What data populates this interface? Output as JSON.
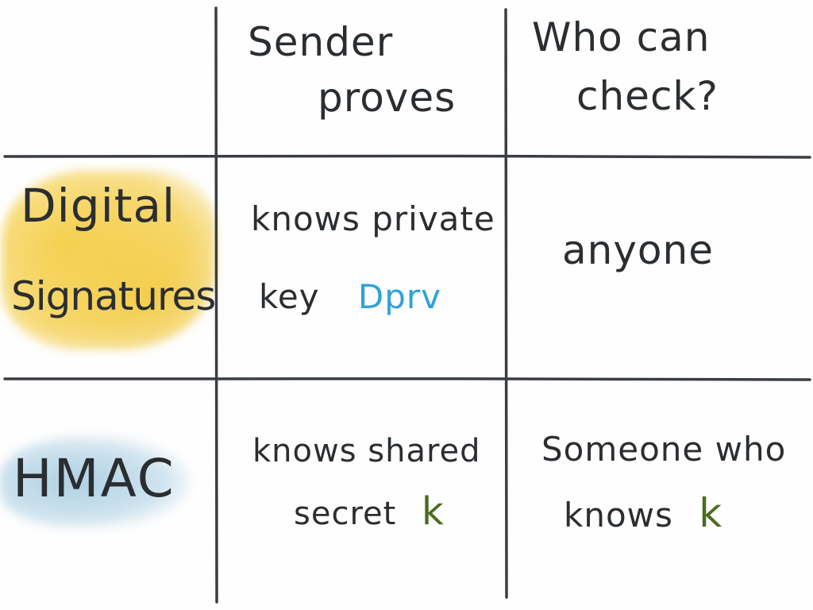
{
  "columns": {
    "sender_proves": [
      "Sender",
      "proves"
    ],
    "who_can_check": [
      "Who can",
      "check?"
    ]
  },
  "rows": [
    {
      "label": [
        "Digital",
        "Signatures"
      ],
      "highlight": "#f2c63a",
      "sender_proves": {
        "line1": "knows private",
        "line2_prefix": "key",
        "key_name": "Dprv",
        "key_color": "#2ea3d8"
      },
      "who_can_check": {
        "line1": "anyone"
      }
    },
    {
      "label": [
        "HMAC"
      ],
      "highlight": "#a9cde0",
      "sender_proves": {
        "line1": "knows shared",
        "line2_prefix": "secret",
        "key_name": "k",
        "key_color": "#4a6b1e"
      },
      "who_can_check": {
        "line1": "Someone who",
        "line2_prefix": "knows",
        "key_name": "k",
        "key_color": "#4a6b1e"
      }
    }
  ],
  "colors": {
    "ink": "#2b2e31",
    "grid": "#3a3e42",
    "background": "#fefefe"
  }
}
